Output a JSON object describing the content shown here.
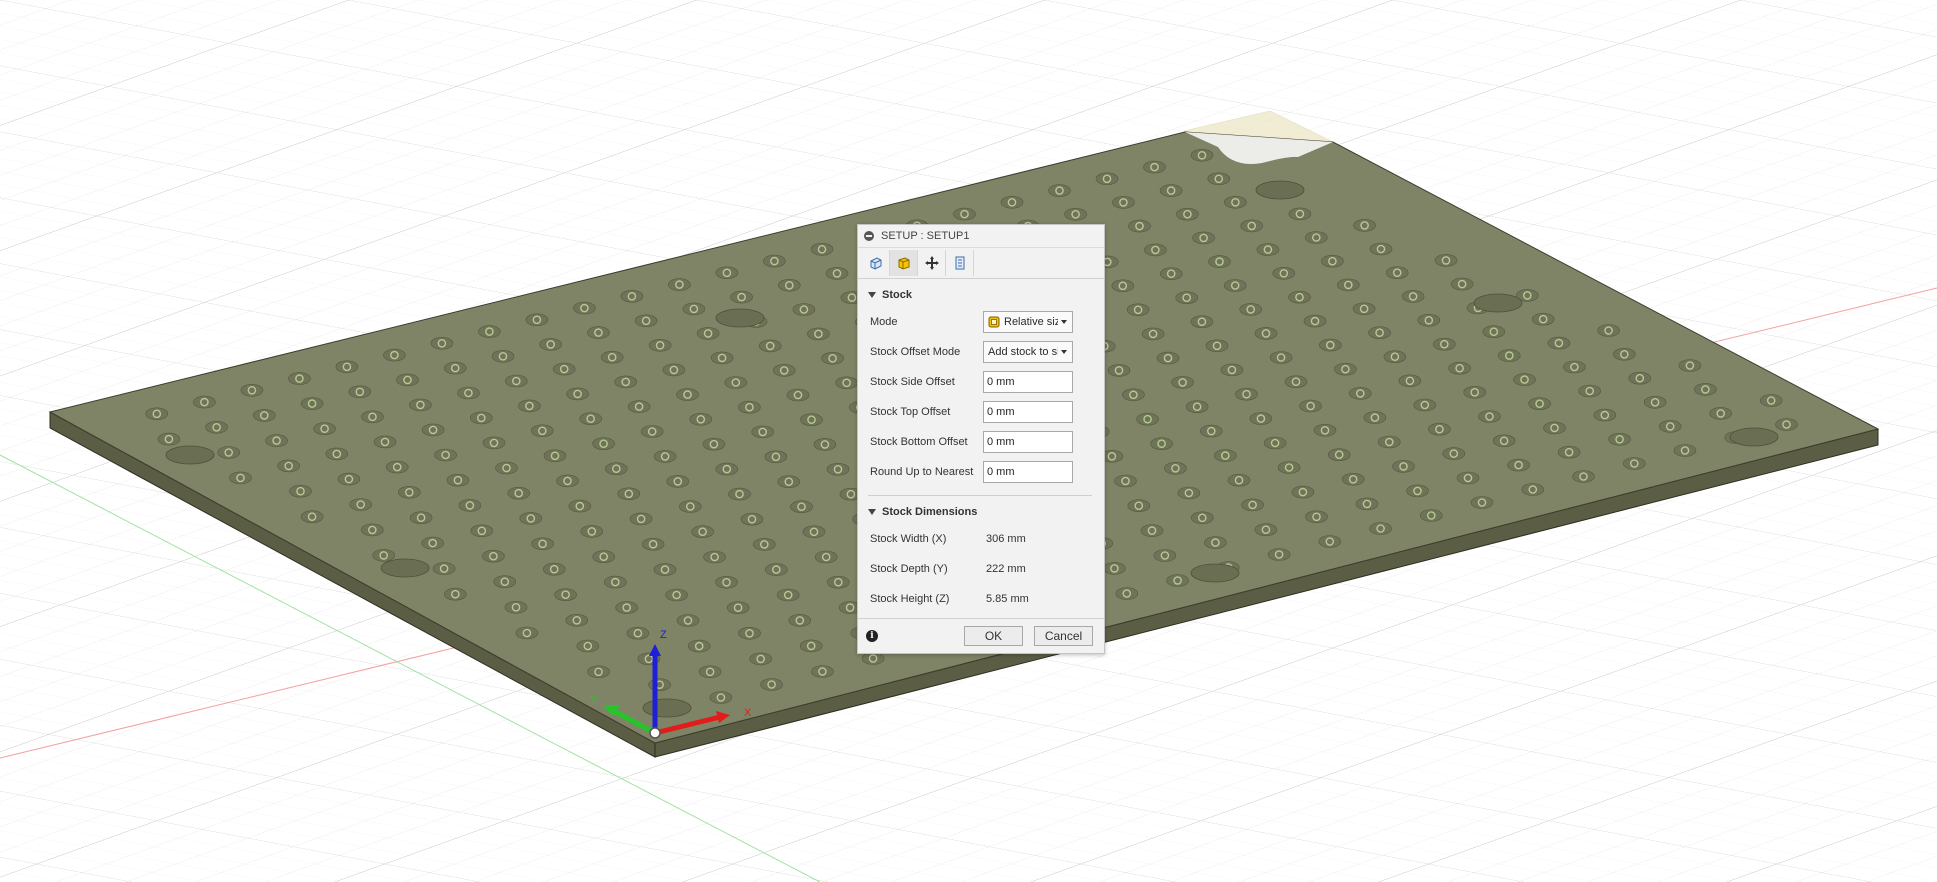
{
  "dialog": {
    "title": "SETUP : SETUP1",
    "tabs": [
      {
        "icon": "setup-icon"
      },
      {
        "icon": "stock-icon"
      },
      {
        "icon": "move-origin-icon"
      },
      {
        "icon": "post-process-icon"
      }
    ],
    "stock_section": {
      "header": "Stock",
      "mode_label": "Mode",
      "mode_value": "Relative size box",
      "offset_mode_label": "Stock Offset Mode",
      "offset_mode_value": "Add stock to sides and top-bottom",
      "side_offset_label": "Stock Side Offset",
      "side_offset_value": "0 mm",
      "top_offset_label": "Stock Top Offset",
      "top_offset_value": "0 mm",
      "bottom_offset_label": "Stock Bottom Offset",
      "bottom_offset_value": "0 mm",
      "round_label": "Round Up to Nearest",
      "round_value": "0 mm"
    },
    "dimensions_section": {
      "header": "Stock Dimensions",
      "width_label": "Stock Width (X)",
      "width_value": "306 mm",
      "depth_label": "Stock Depth (Y)",
      "depth_value": "222 mm",
      "height_label": "Stock Height (Z)",
      "height_value": "5.85 mm"
    },
    "ok_label": "OK",
    "cancel_label": "Cancel"
  },
  "viewport": {
    "axes": {
      "x": "X",
      "y": "Y",
      "z": "Z"
    },
    "colors": {
      "plate_top": "#808466",
      "plate_side": "#5b5d45",
      "hole": "#b7c896",
      "x_axis": "#e21b1b",
      "y_axis": "#25c52a",
      "z_axis": "#1f1fd8"
    }
  }
}
